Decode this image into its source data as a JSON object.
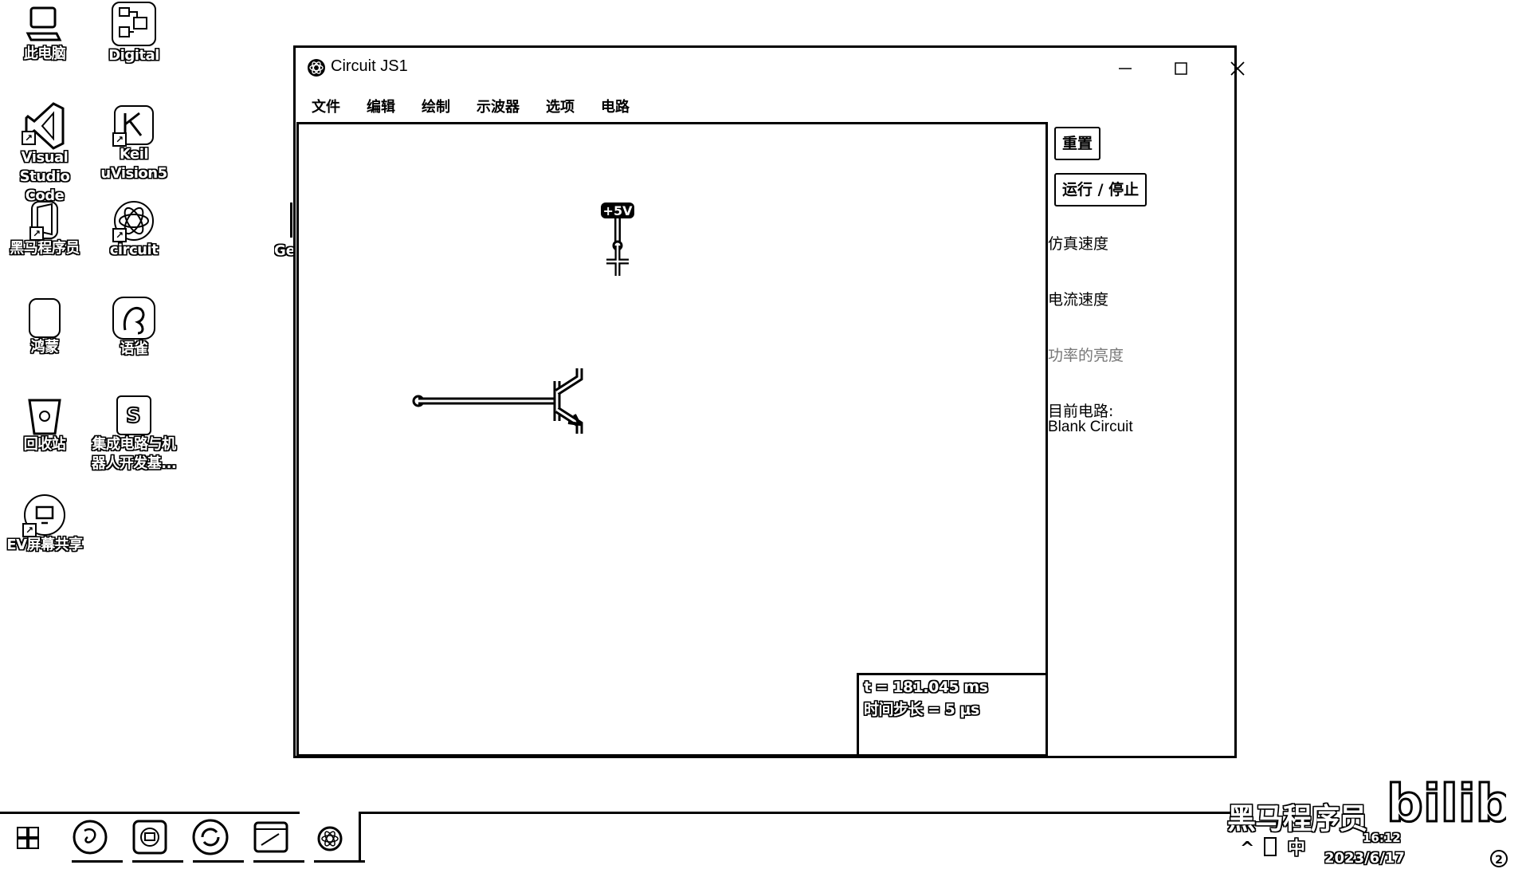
{
  "desktop": {
    "icons": [
      {
        "label_lines": [
          "此电脑"
        ],
        "icon": "computer-icon"
      },
      {
        "label_lines": [
          "Digital"
        ],
        "icon": "digital-icon"
      },
      {
        "label_lines": [
          "Visual",
          "Studio Code"
        ],
        "icon": "vscode-icon"
      },
      {
        "label_lines": [
          "Keil",
          "uVision5"
        ],
        "icon": "keil-icon"
      },
      {
        "label_lines": [
          "黑马程序员"
        ],
        "icon": "heima-icon"
      },
      {
        "label_lines": [
          "circuit"
        ],
        "icon": "circuit-icon"
      },
      {
        "label_lines": [
          "鸿蒙"
        ],
        "icon": "harmony-icon"
      },
      {
        "label_lines": [
          "语雀"
        ],
        "icon": "yuque-icon"
      },
      {
        "label_lines": [
          "回收站"
        ],
        "icon": "recycle-bin-icon"
      },
      {
        "label_lines": [
          "集成电路与机",
          "器人开发基..."
        ],
        "icon": "document-icon"
      },
      {
        "label_lines": [
          "EV屏幕共享"
        ],
        "icon": "screen-share-icon"
      }
    ],
    "partial_label": "Ge"
  },
  "window": {
    "title": "Circuit JS1",
    "menu": [
      "文件",
      "编辑",
      "绘制",
      "示波器",
      "选项",
      "电路"
    ],
    "canvas": {
      "voltage_label": "+5V",
      "time_text": "t = 181.045 ms",
      "timestep_text": "时间步长 = 5 μs"
    },
    "side": {
      "reset_button": "重置",
      "run_stop_button": "运行 / 停止",
      "sim_speed_label": "仿真速度",
      "current_speed_label": "电流速度",
      "power_brightness_label": "功率的亮度",
      "current_circuit_label": "目前电路:",
      "current_circuit_name": "Blank Circuit"
    }
  },
  "taskbar": {
    "items": [
      "start-icon",
      "browser-icon",
      "screen-share-icon",
      "sync-icon",
      "window-icon",
      "circuit-icon"
    ],
    "tray_ime": "中",
    "time": "16:12",
    "date": "2023/6/17",
    "notification_count": "2",
    "watermark": "黑马程序员",
    "watermark_logo": "bilibili"
  }
}
